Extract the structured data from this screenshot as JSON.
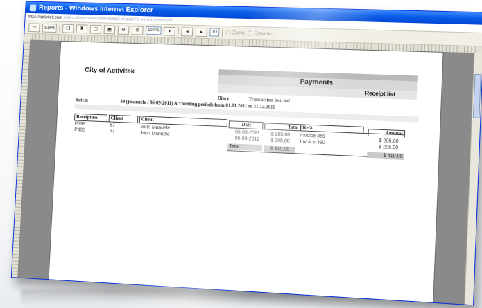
{
  "window": {
    "title": "Reports - Windows Internet Explorer",
    "address_prefix": "https://",
    "address_host": "activitek.com",
    "address_rest": "/internal/reports/receipt/ReceiptList.aspx?id=report-viewer-pdf"
  },
  "toolbar": {
    "save_label": "Save",
    "zoom_value": "100 %",
    "page_value": "1/1",
    "zoom_out_label": "Zoom",
    "zoom_in_label": "Dynamic"
  },
  "report": {
    "company": "City of Activitek",
    "title": "Payments",
    "subtitle": "Receipt list",
    "diary_label": "Diary:",
    "diary_value": "Transaction journal",
    "batch_label": "Batch:",
    "batch_value": "39 (jmanuele / 06-09-2011) Accounting periods from 01.01.2011 to 31.12.2011",
    "columns": {
      "receipt_no": "Receipt no.",
      "client_id": "Client",
      "client_name": "Client",
      "date": "Date",
      "total": "Total",
      "ref": "Ref#",
      "amount": "Amount"
    },
    "rows": [
      {
        "receipt_no": "P399",
        "client_id": "57",
        "client_name": "John Manuele",
        "date": "06-09-2011",
        "total": "$ 205.00",
        "ref": "Invoice 389",
        "amount": "$ 205.00"
      },
      {
        "receipt_no": "P400",
        "client_id": "57",
        "client_name": "John Manuele",
        "date": "06-09-2011",
        "total": "$ 205.00",
        "ref": "Invoice 390",
        "amount": "$ 205.00"
      }
    ],
    "total_label": "Total",
    "total_value": "$ 410.00",
    "amount_total": "$ 410.00"
  }
}
